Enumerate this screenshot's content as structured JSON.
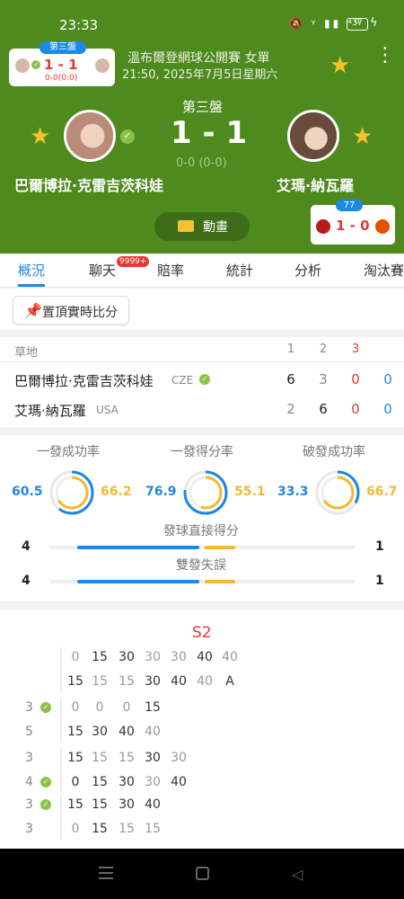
{
  "status": {
    "time": "23:33",
    "battery": "37"
  },
  "mini": {
    "set_badge": "第三盤",
    "score": "1 - 1",
    "sub": "0-0(0:0)"
  },
  "match": {
    "tournament": "溫布爾登網球公開賽 女單",
    "datetime": "21:50, 2025年7月5日星期六",
    "set_label": "第三盤",
    "score": "1 - 1",
    "game_score": "0-0 (0-0)",
    "player1": "巴爾博拉·克雷吉茨科娃",
    "player2": "艾瑪·納瓦羅",
    "animation_label": "動畫",
    "live_count": "77",
    "live_score": "1 - 0"
  },
  "tabs": [
    {
      "label": "概況"
    },
    {
      "label": "聊天",
      "badge": "9999+"
    },
    {
      "label": "賠率"
    },
    {
      "label": "統計"
    },
    {
      "label": "分析"
    },
    {
      "label": "淘汰賽"
    }
  ],
  "pin_label": "置頂實時比分",
  "scoreboard": {
    "surface": "草地",
    "sets": [
      "1",
      "2",
      "3"
    ],
    "rows": [
      {
        "name": "巴爾博拉·克雷吉茨科娃",
        "country": "CZE",
        "scores": [
          "6",
          "3",
          "0",
          "0"
        ]
      },
      {
        "name": "艾瑪·納瓦羅",
        "country": "USA",
        "scores": [
          "2",
          "6",
          "0",
          "0"
        ]
      }
    ]
  },
  "stats": {
    "rings": [
      {
        "label": "一發成功率",
        "left": "60.5",
        "right": "66.2",
        "lv": 60.5,
        "rv": 66.2
      },
      {
        "label": "一發得分率",
        "left": "76.9",
        "right": "55.1",
        "lv": 76.9,
        "rv": 55.1
      },
      {
        "label": "破發成功率",
        "left": "33.3",
        "right": "66.7",
        "lv": 33.3,
        "rv": 66.7
      }
    ],
    "bars": [
      {
        "label": "發球直接得分",
        "left": "4",
        "right": "1",
        "lv": 4,
        "rv": 1
      },
      {
        "label": "雙發失誤",
        "left": "4",
        "right": "1",
        "lv": 4,
        "rv": 1
      }
    ],
    "colors": {
      "blue": "#1e88e5",
      "yellow": "#f5b82e"
    }
  },
  "pbp": {
    "set": "S2",
    "games": [
      {
        "side": {
          "top": "",
          "bottom": ""
        },
        "top": [
          "0",
          "15",
          "30",
          "30",
          "30",
          "40",
          "40"
        ],
        "bottom": [
          "15",
          "15",
          "15",
          "30",
          "40",
          "40",
          "A"
        ]
      },
      {
        "side": {
          "top": "3",
          "bottom": "5"
        },
        "check": "top",
        "top": [
          "0",
          "0",
          "0",
          "15"
        ],
        "bottom": [
          "15",
          "30",
          "40",
          "40"
        ]
      },
      {
        "side": {
          "top": "3",
          "bottom": "4"
        },
        "check": "bottom",
        "top": [
          "15",
          "15",
          "15",
          "30",
          "30"
        ],
        "bottom": [
          "0",
          "15",
          "30",
          "30",
          "40"
        ]
      },
      {
        "side": {
          "top": "3",
          "bottom": "3"
        },
        "check": "top",
        "top": [
          "15",
          "15",
          "30",
          "40"
        ],
        "bottom": [
          "0",
          "15",
          "15",
          "15"
        ]
      }
    ]
  }
}
